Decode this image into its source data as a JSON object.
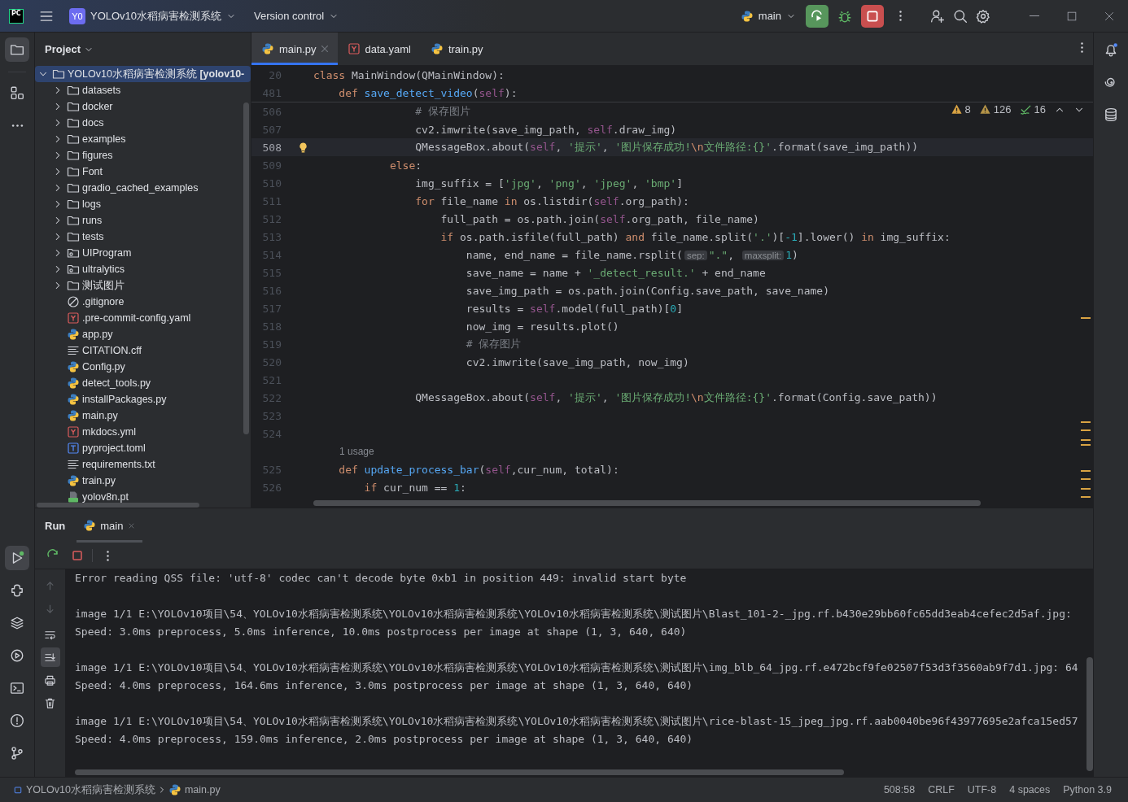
{
  "title_bar": {
    "logo": "PC",
    "project_badge": "Y0",
    "project_name": "YOLOv10水稻病害检测系统",
    "vcs": "Version control",
    "run_config": "main"
  },
  "left_stripe": {
    "top": [
      {
        "kind": "project",
        "selected": true
      },
      {
        "kind": "structure",
        "selected": false
      },
      {
        "kind": "more",
        "selected": false
      }
    ],
    "bottom": [
      {
        "kind": "run",
        "selected": true
      },
      {
        "kind": "python",
        "selected": false
      },
      {
        "kind": "layers",
        "selected": false
      },
      {
        "kind": "services",
        "selected": false
      },
      {
        "kind": "terminal",
        "selected": false
      },
      {
        "kind": "problems",
        "selected": false
      },
      {
        "kind": "git",
        "selected": false
      }
    ]
  },
  "project_panel": {
    "title": "Project",
    "tree": [
      {
        "name": "YOLOv10水稻病害检测系统",
        "suffix": "[yolov10-",
        "kind": "folder",
        "expanded": true,
        "selected": true,
        "children": [
          {
            "name": "datasets",
            "kind": "folder",
            "expanded": false,
            "selected": false
          },
          {
            "name": "docker",
            "kind": "folder",
            "expanded": false,
            "selected": false
          },
          {
            "name": "docs",
            "kind": "folder",
            "expanded": false,
            "selected": false
          },
          {
            "name": "examples",
            "kind": "folder",
            "expanded": false,
            "selected": false
          },
          {
            "name": "figures",
            "kind": "folder",
            "expanded": false,
            "selected": false
          },
          {
            "name": "Font",
            "kind": "folder",
            "expanded": false,
            "selected": false
          },
          {
            "name": "gradio_cached_examples",
            "kind": "folder",
            "expanded": false,
            "selected": false
          },
          {
            "name": "logs",
            "kind": "folder",
            "expanded": false,
            "selected": false
          },
          {
            "name": "runs",
            "kind": "folder",
            "expanded": false,
            "selected": false
          },
          {
            "name": "tests",
            "kind": "folder",
            "expanded": false,
            "selected": false
          },
          {
            "name": "UIProgram",
            "kind": "module",
            "expanded": false,
            "selected": false
          },
          {
            "name": "ultralytics",
            "kind": "module",
            "expanded": false,
            "selected": false
          },
          {
            "name": "测试图片",
            "kind": "folder",
            "expanded": false,
            "selected": false
          },
          {
            "name": ".gitignore",
            "kind": "ignore",
            "selected": false
          },
          {
            "name": ".pre-commit-config.yaml",
            "kind": "yaml",
            "selected": false
          },
          {
            "name": "app.py",
            "kind": "python",
            "selected": false
          },
          {
            "name": "CITATION.cff",
            "kind": "text",
            "selected": false
          },
          {
            "name": "Config.py",
            "kind": "python",
            "selected": false
          },
          {
            "name": "detect_tools.py",
            "kind": "python",
            "selected": false
          },
          {
            "name": "installPackages.py",
            "kind": "python",
            "selected": false
          },
          {
            "name": "main.py",
            "kind": "python",
            "selected": false
          },
          {
            "name": "mkdocs.yml",
            "kind": "yaml",
            "selected": false
          },
          {
            "name": "pyproject.toml",
            "kind": "toml",
            "selected": false
          },
          {
            "name": "requirements.txt",
            "kind": "text",
            "selected": false
          },
          {
            "name": "train.py",
            "kind": "python",
            "selected": false
          },
          {
            "name": "yolov8n.pt",
            "kind": "binary",
            "selected": false
          }
        ]
      }
    ]
  },
  "editor": {
    "tabs": [
      {
        "label": "main.py",
        "kind": "python",
        "selected": true,
        "closable": true
      },
      {
        "label": "data.yaml",
        "kind": "yaml",
        "selected": false,
        "closable": false
      },
      {
        "label": "train.py",
        "kind": "python",
        "selected": false,
        "closable": false
      }
    ],
    "inspections": [
      {
        "kind": "error",
        "count": "8"
      },
      {
        "kind": "warning",
        "count": "126"
      },
      {
        "kind": "typo",
        "count": "16"
      }
    ],
    "sticky_lines": [
      {
        "number": "20",
        "tokens": [
          {
            "kind": "k",
            "text": "class"
          },
          {
            "kind": "p",
            "text": " MainWindow(QMainWindow):"
          }
        ]
      },
      {
        "number": "481",
        "tokens": [
          {
            "kind": "k",
            "text": "    def"
          },
          {
            "kind": "f",
            "text": " save_detect_video"
          },
          {
            "kind": "p",
            "text": "("
          },
          {
            "kind": "s",
            "text": "self"
          },
          {
            "kind": "p",
            "text": "):"
          }
        ]
      }
    ],
    "lines": [
      {
        "number": "506",
        "current": false,
        "tokens": [
          {
            "kind": "c",
            "text": "                # 保存图片"
          }
        ]
      },
      {
        "number": "507",
        "current": false,
        "tokens": [
          {
            "kind": "p",
            "text": "                cv2.imwrite(save_img_path, "
          },
          {
            "kind": "s",
            "text": "self"
          },
          {
            "kind": "p",
            "text": ".draw_img)"
          }
        ]
      },
      {
        "number": "508",
        "current": true,
        "tokens": [
          {
            "kind": "p",
            "text": "                QMessageBox.about("
          },
          {
            "kind": "s",
            "text": "self"
          },
          {
            "kind": "p",
            "text": ", "
          },
          {
            "kind": "str",
            "text": "'提示'"
          },
          {
            "kind": "p",
            "text": ", "
          },
          {
            "kind": "str",
            "text": "'图片保存成功!"
          },
          {
            "kind": "e",
            "text": "\\n"
          },
          {
            "kind": "str",
            "text": "文件路径:{}'"
          },
          {
            "kind": "p",
            "text": ".format(save_img_path))"
          }
        ]
      },
      {
        "number": "509",
        "current": false,
        "tokens": [
          {
            "kind": "k",
            "text": "            else"
          },
          {
            "kind": "p",
            "text": ":"
          }
        ]
      },
      {
        "number": "510",
        "current": false,
        "tokens": [
          {
            "kind": "p",
            "text": "                img_suffix = ["
          },
          {
            "kind": "str",
            "text": "'jpg'"
          },
          {
            "kind": "p",
            "text": ", "
          },
          {
            "kind": "str",
            "text": "'png'"
          },
          {
            "kind": "p",
            "text": ", "
          },
          {
            "kind": "str",
            "text": "'jpeg'"
          },
          {
            "kind": "p",
            "text": ", "
          },
          {
            "kind": "str",
            "text": "'bmp'"
          },
          {
            "kind": "p",
            "text": "]"
          }
        ]
      },
      {
        "number": "511",
        "current": false,
        "tokens": [
          {
            "kind": "k",
            "text": "                for"
          },
          {
            "kind": "p",
            "text": " file_name "
          },
          {
            "kind": "k",
            "text": "in"
          },
          {
            "kind": "p",
            "text": " os.listdir("
          },
          {
            "kind": "s",
            "text": "self"
          },
          {
            "kind": "p",
            "text": ".org_path):"
          }
        ]
      },
      {
        "number": "512",
        "current": false,
        "tokens": [
          {
            "kind": "p",
            "text": "                    full_path = os.path.join("
          },
          {
            "kind": "s",
            "text": "self"
          },
          {
            "kind": "p",
            "text": ".org_path, file_name)"
          }
        ]
      },
      {
        "number": "513",
        "current": false,
        "tokens": [
          {
            "kind": "k",
            "text": "                    if"
          },
          {
            "kind": "p",
            "text": " os.path.isfile(full_path) "
          },
          {
            "kind": "k",
            "text": "and"
          },
          {
            "kind": "p",
            "text": " file_name.split("
          },
          {
            "kind": "str",
            "text": "'.'"
          },
          {
            "kind": "p",
            "text": ")["
          },
          {
            "kind": "n",
            "text": "-1"
          },
          {
            "kind": "p",
            "text": "].lower() "
          },
          {
            "kind": "k",
            "text": "in"
          },
          {
            "kind": "p",
            "text": " img_suffix:"
          }
        ]
      },
      {
        "number": "514",
        "current": false,
        "tokens": [
          {
            "kind": "p",
            "text": "                        name, end_name = file_name.rsplit("
          },
          {
            "kind": "h",
            "text": "sep:"
          },
          {
            "kind": "str",
            "text": "\".\""
          },
          {
            "kind": "p",
            "text": ", "
          },
          {
            "kind": "h",
            "text": "maxsplit:"
          },
          {
            "kind": "n",
            "text": "1"
          },
          {
            "kind": "p",
            "text": ")"
          }
        ]
      },
      {
        "number": "515",
        "current": false,
        "tokens": [
          {
            "kind": "p",
            "text": "                        save_name = name + "
          },
          {
            "kind": "str",
            "text": "'_detect_result.'"
          },
          {
            "kind": "p",
            "text": " + end_name"
          }
        ]
      },
      {
        "number": "516",
        "current": false,
        "tokens": [
          {
            "kind": "p",
            "text": "                        save_img_path = os.path.join(Config.save_path, save_name)"
          }
        ]
      },
      {
        "number": "517",
        "current": false,
        "tokens": [
          {
            "kind": "p",
            "text": "                        results = "
          },
          {
            "kind": "s",
            "text": "self"
          },
          {
            "kind": "p",
            "text": ".model(full_path)["
          },
          {
            "kind": "n",
            "text": "0"
          },
          {
            "kind": "p",
            "text": "]"
          }
        ]
      },
      {
        "number": "518",
        "current": false,
        "tokens": [
          {
            "kind": "p",
            "text": "                        now_img = results.plot()"
          }
        ]
      },
      {
        "number": "519",
        "current": false,
        "tokens": [
          {
            "kind": "c",
            "text": "                        # 保存图片"
          }
        ]
      },
      {
        "number": "520",
        "current": false,
        "tokens": [
          {
            "kind": "p",
            "text": "                        cv2.imwrite(save_img_path, now_img)"
          }
        ]
      },
      {
        "number": "521",
        "current": false
      },
      {
        "number": "522",
        "current": false,
        "tokens": [
          {
            "kind": "p",
            "text": "                QMessageBox.about("
          },
          {
            "kind": "s",
            "text": "self"
          },
          {
            "kind": "p",
            "text": ", "
          },
          {
            "kind": "str",
            "text": "'提示'"
          },
          {
            "kind": "p",
            "text": ", "
          },
          {
            "kind": "str",
            "text": "'图片保存成功!"
          },
          {
            "kind": "e",
            "text": "\\n"
          },
          {
            "kind": "str",
            "text": "文件路径:{}'"
          },
          {
            "kind": "p",
            "text": ".format(Config.save_path))"
          }
        ]
      },
      {
        "number": "523",
        "current": false
      },
      {
        "number": "524",
        "current": false
      },
      {
        "kind": "usage",
        "text": "1 usage"
      },
      {
        "number": "525",
        "current": false,
        "tokens": [
          {
            "kind": "k",
            "text": "    def"
          },
          {
            "kind": "f",
            "text": " update_process_bar"
          },
          {
            "kind": "p",
            "text": "("
          },
          {
            "kind": "s",
            "text": "self"
          },
          {
            "kind": "p",
            "text": ",cur_num, total):"
          }
        ]
      },
      {
        "number": "526",
        "current": false,
        "tokens": [
          {
            "kind": "k",
            "text": "        if"
          },
          {
            "kind": "p",
            "text": " cur_num == "
          },
          {
            "kind": "n",
            "text": "1"
          },
          {
            "kind": "p",
            "text": ":"
          }
        ]
      }
    ]
  },
  "run_panel": {
    "title": "Run",
    "tabs": [
      {
        "label": "main",
        "selected": true
      }
    ],
    "side_tools": [
      {
        "kind": "up",
        "selected": false
      },
      {
        "kind": "down",
        "selected": false
      },
      {
        "kind": "wrap",
        "selected": false
      },
      {
        "kind": "scroll-end",
        "selected": true
      },
      {
        "kind": "print",
        "selected": false
      },
      {
        "kind": "trash",
        "selected": false
      }
    ],
    "output": [
      [
        "Error reading QSS file: 'utf-8' codec can't decode byte 0xb1 in position 449: invalid start byte"
      ],
      [
        "image 1/1 E:\\YOLOv10项目\\54、YOLOv10水稻病害检测系统\\YOLOv10水稻病害检测系统\\YOLOv10水稻病害检测系统\\测试图片\\Blast_101-2-_jpg.rf.b430e29bb60fc65dd3eab4cefec2d5af.jpg:",
        "Speed: 3.0ms preprocess, 5.0ms inference, 10.0ms postprocess per image at shape (1, 3, 640, 640)"
      ],
      [
        "image 1/1 E:\\YOLOv10项目\\54、YOLOv10水稻病害检测系统\\YOLOv10水稻病害检测系统\\YOLOv10水稻病害检测系统\\测试图片\\img_blb_64_jpg.rf.e472bcf9fe02507f53d3f3560ab9f7d1.jpg: 64",
        "Speed: 4.0ms preprocess, 164.6ms inference, 3.0ms postprocess per image at shape (1, 3, 640, 640)"
      ],
      [
        "image 1/1 E:\\YOLOv10项目\\54、YOLOv10水稻病害检测系统\\YOLOv10水稻病害检测系统\\YOLOv10水稻病害检测系统\\测试图片\\rice-blast-15_jpeg_jpg.rf.aab0040be96f43977695e2afca15ed57",
        "Speed: 4.0ms preprocess, 159.0ms inference, 2.0ms postprocess per image at shape (1, 3, 640, 640)"
      ]
    ]
  },
  "status_bar": {
    "breadcrumbs": [
      {
        "label": "YOLOv10水稻病害检测系统",
        "kind": "project"
      },
      {
        "label": "main.py",
        "kind": "python"
      }
    ],
    "items": [
      "508:58",
      "CRLF",
      "UTF-8",
      "4 spaces",
      "Python 3.9"
    ]
  }
}
